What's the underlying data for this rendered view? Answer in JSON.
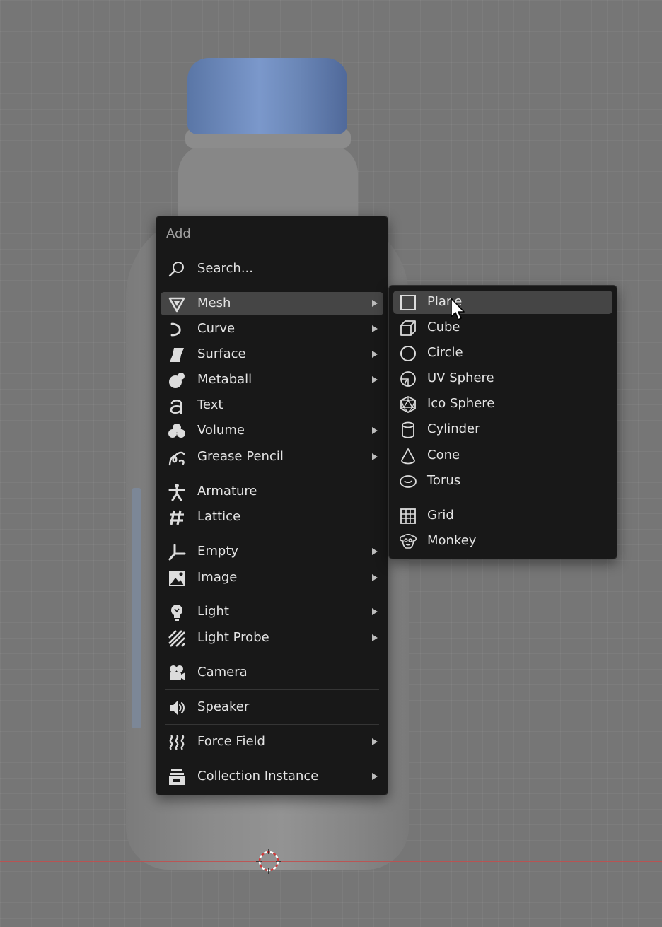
{
  "add_menu": {
    "title": "Add",
    "search": {
      "label": "Search...",
      "icon": "search-icon"
    },
    "items": [
      {
        "label": "Mesh",
        "icon": "mesh-icon",
        "submenu": true,
        "highlighted": true
      },
      {
        "label": "Curve",
        "icon": "curve-icon",
        "submenu": true
      },
      {
        "label": "Surface",
        "icon": "surface-icon",
        "submenu": true
      },
      {
        "label": "Metaball",
        "icon": "metaball-icon",
        "submenu": true
      },
      {
        "label": "Text",
        "icon": "text-icon",
        "submenu": false
      },
      {
        "label": "Volume",
        "icon": "volume-icon",
        "submenu": true
      },
      {
        "label": "Grease Pencil",
        "icon": "grease-pencil-icon",
        "submenu": true
      },
      {
        "label": "Armature",
        "icon": "armature-icon",
        "submenu": false
      },
      {
        "label": "Lattice",
        "icon": "lattice-icon",
        "submenu": false
      },
      {
        "label": "Empty",
        "icon": "empty-icon",
        "submenu": true
      },
      {
        "label": "Image",
        "icon": "image-icon",
        "submenu": true
      },
      {
        "label": "Light",
        "icon": "light-icon",
        "submenu": true
      },
      {
        "label": "Light Probe",
        "icon": "light-probe-icon",
        "submenu": true
      },
      {
        "label": "Camera",
        "icon": "camera-icon",
        "submenu": false
      },
      {
        "label": "Speaker",
        "icon": "speaker-icon",
        "submenu": false
      },
      {
        "label": "Force Field",
        "icon": "force-field-icon",
        "submenu": true
      },
      {
        "label": "Collection Instance",
        "icon": "collection-instance-icon",
        "submenu": true
      }
    ]
  },
  "mesh_submenu": {
    "items": [
      {
        "label": "Plane",
        "icon": "plane-icon",
        "highlighted": true
      },
      {
        "label": "Cube",
        "icon": "cube-icon"
      },
      {
        "label": "Circle",
        "icon": "circle-icon"
      },
      {
        "label": "UV Sphere",
        "icon": "uv-sphere-icon"
      },
      {
        "label": "Ico Sphere",
        "icon": "ico-sphere-icon"
      },
      {
        "label": "Cylinder",
        "icon": "cylinder-icon"
      },
      {
        "label": "Cone",
        "icon": "cone-icon"
      },
      {
        "label": "Torus",
        "icon": "torus-icon"
      },
      {
        "label": "Grid",
        "icon": "grid-icon"
      },
      {
        "label": "Monkey",
        "icon": "monkey-icon"
      }
    ]
  },
  "colors": {
    "menu_bg": "#181818",
    "highlight": "#454545",
    "text": "#e4e4e4",
    "header_text": "#a0a0a0",
    "axis_x": "#c05050",
    "axis_y": "#5a79c7",
    "viewport_bg": "#767676"
  }
}
